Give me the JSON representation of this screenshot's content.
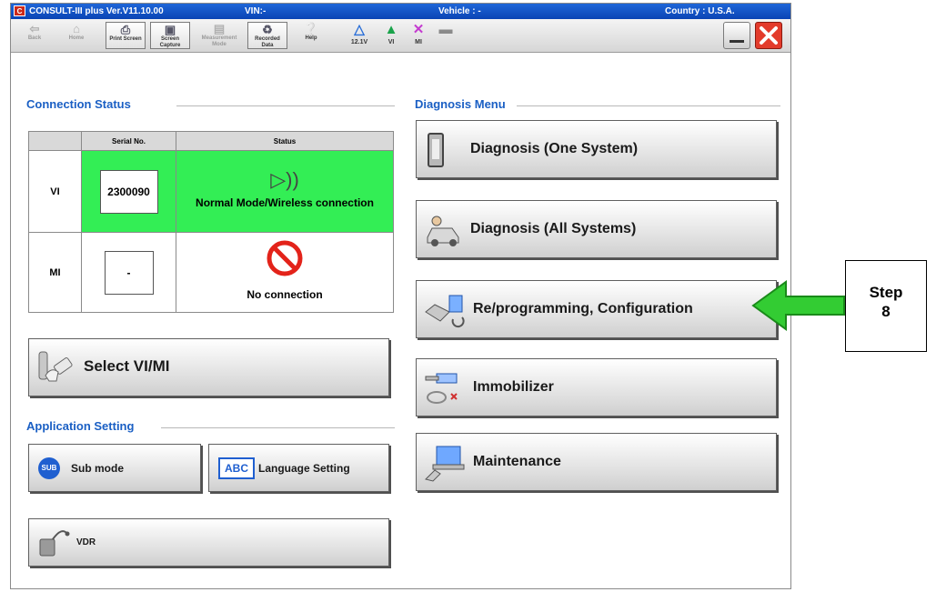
{
  "titlebar": {
    "app": "CONSULT-III plus  Ver.V11.10.00",
    "vin": "VIN:-",
    "vehicle": "Vehicle : -",
    "country": "Country : U.S.A."
  },
  "toolbar": {
    "back": "Back",
    "home": "Home",
    "print": "Print Screen",
    "capture": "Screen Capture",
    "measurement": "Measurement Mode",
    "recorded": "Recorded Data",
    "help": "Help",
    "voltage": "12.1V",
    "vi": "VI",
    "mi": "MI"
  },
  "connection": {
    "title": "Connection Status",
    "col_serial": "Serial No.",
    "col_status": "Status",
    "vi_label": "VI",
    "vi_serial": "2300090",
    "vi_status": "Normal Mode/Wireless connection",
    "mi_label": "MI",
    "mi_serial": "-",
    "mi_status": "No connection"
  },
  "select_vimi": "Select VI/MI",
  "app_setting": {
    "title": "Application Setting",
    "sub_mode": "Sub mode",
    "language": "Language Setting",
    "sub_badge": "SUB",
    "abc_badge": "ABC"
  },
  "vdr": "VDR",
  "diagnosis": {
    "title": "Diagnosis Menu",
    "one_system": "Diagnosis (One System)",
    "all_systems": "Diagnosis (All Systems)",
    "reprogramming": "Re/programming, Configuration",
    "immobilizer": "Immobilizer",
    "maintenance": "Maintenance"
  },
  "callout": {
    "line1": "Step",
    "line2": "8",
    "arrow_color": "#33cc33"
  },
  "colors": {
    "title_blue": "#1a5fc4",
    "status_green": "#33ee55",
    "close_red": "#e33b2b"
  }
}
